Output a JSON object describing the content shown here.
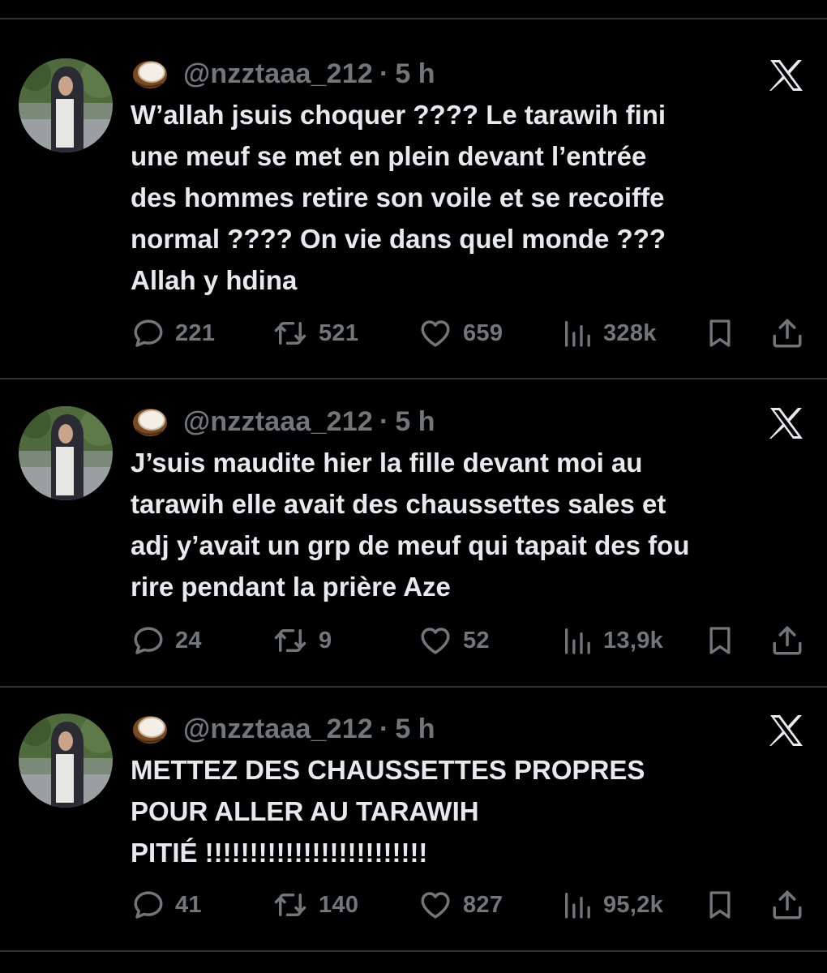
{
  "tweets": [
    {
      "handle": "@nzztaaa_212",
      "separator": "·",
      "time": "5 h",
      "text": "W’allah jsuis choquer ???? Le tarawih fini\nune meuf se met en plein devant l’entrée\ndes hommes retire son voile et se recoiffe\nnormal ???? On vie dans quel monde ???\nAllah y hdina",
      "replies": "221",
      "reposts": "521",
      "likes": "659",
      "views": "328k"
    },
    {
      "handle": "@nzztaaa_212",
      "separator": "·",
      "time": "5 h",
      "text": "J’suis maudite hier la fille devant moi au\ntarawih elle avait des chaussettes sales et\nadj y’avait un grp de meuf qui tapait des fou\nrire pendant la prière Aze",
      "replies": "24",
      "reposts": "9",
      "likes": "52",
      "views": "13,9k"
    },
    {
      "handle": "@nzztaaa_212",
      "separator": "·",
      "time": "5 h",
      "text": "METTEZ DES CHAUSSETTES PROPRES\nPOUR ALLER AU TARAWIH\nPITIÉ !!!!!!!!!!!!!!!!!!!!!!!!!",
      "replies": "41",
      "reposts": "140",
      "likes": "827",
      "views": "95,2k"
    }
  ],
  "icons": {
    "name_emoji": "coconut-icon",
    "source": "x-logo-icon",
    "reply": "reply-icon",
    "repost": "repost-icon",
    "like": "like-icon",
    "views": "views-icon",
    "bookmark": "bookmark-icon",
    "share": "share-icon"
  },
  "colors": {
    "background": "#000000",
    "text": "#e7e9ea",
    "secondary": "#71767b",
    "divider": "#2f3336"
  }
}
